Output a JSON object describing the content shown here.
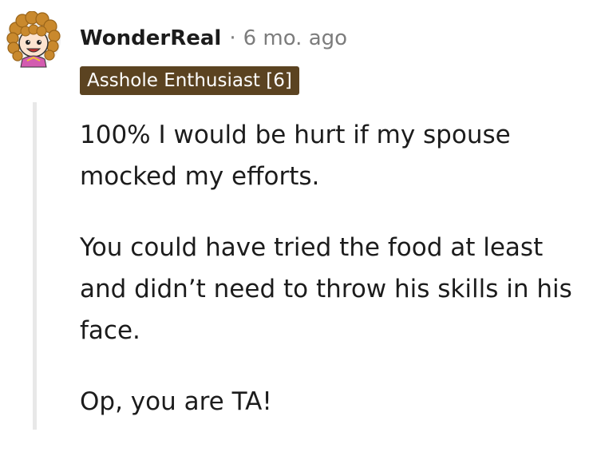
{
  "comment": {
    "avatar_icon": "curly-haired-cartoon-avatar-icon",
    "username": "WonderReal",
    "separator": "·",
    "timestamp": "6 mo. ago",
    "flair": "Asshole Enthusiast [6]",
    "flair_color": "#5b4321",
    "paragraphs": [
      "100% I would be hurt if my spouse mocked my efforts.",
      "You could have tried the food at least and didn’t need to throw his skills in his face.",
      "Op, you are TA!"
    ]
  }
}
